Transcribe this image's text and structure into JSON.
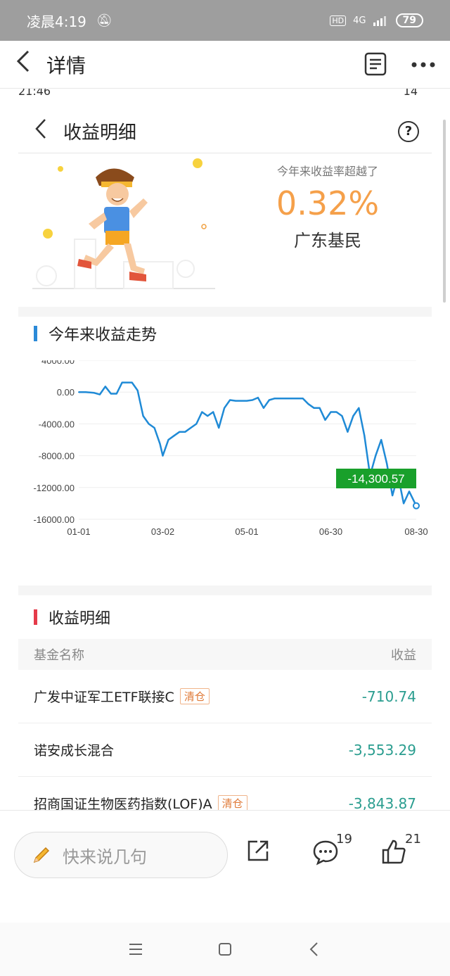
{
  "status_bar": {
    "time": "凌晨4:19",
    "network": "4G",
    "battery": "79"
  },
  "appbar": {
    "title": "详情"
  },
  "inner": {
    "status_time": "21:46",
    "status_battery": "14",
    "title": "收益明细",
    "hero": {
      "hint": "今年来收益率超越了",
      "percent": "0.32%",
      "who": "广东基民"
    }
  },
  "trend": {
    "title": "今年来收益走势",
    "accent": "#2b8ad8",
    "line_color": "#1f8ad6",
    "label_color": "#19a02b"
  },
  "chart_data": {
    "type": "line",
    "title": "今年来收益走势",
    "y_ticks": [
      "4000.00",
      "0.00",
      "-4000.00",
      "-8000.00",
      "-12000.00",
      "-16000.00"
    ],
    "x_ticks": [
      "01-01",
      "03-02",
      "05-01",
      "06-30",
      "08-30"
    ],
    "ylim": [
      -16000,
      4000
    ],
    "last_value_label": "-14,300.57",
    "series": [
      {
        "x": [
          "01-01",
          "01-06",
          "01-12",
          "01-16",
          "01-20",
          "01-24",
          "01-28",
          "02-01",
          "02-05",
          "02-08",
          "02-12",
          "02-16",
          "02-20",
          "02-24",
          "02-28",
          "03-02",
          "03-06",
          "03-10",
          "03-14",
          "03-18",
          "03-22",
          "03-26",
          "03-30",
          "04-03",
          "04-07",
          "04-11",
          "04-15",
          "04-19",
          "04-23",
          "04-27",
          "05-01",
          "05-05",
          "05-09",
          "05-13",
          "05-17",
          "05-21",
          "05-25",
          "05-29",
          "06-02",
          "06-06",
          "06-10",
          "06-14",
          "06-18",
          "06-22",
          "06-26",
          "06-30",
          "07-04",
          "07-08",
          "07-12",
          "07-16",
          "07-20",
          "07-24",
          "07-28",
          "08-01",
          "08-05",
          "08-09",
          "08-13",
          "08-17",
          "08-21",
          "08-25",
          "08-30"
        ],
        "values": [
          0,
          0,
          -100,
          -300,
          700,
          -200,
          -200,
          1200,
          1200,
          1200,
          200,
          -3000,
          -4000,
          -4500,
          -6500,
          -8000,
          -6000,
          -5500,
          -5000,
          -5000,
          -4500,
          -4000,
          -2500,
          -3000,
          -2500,
          -4500,
          -2000,
          -1000,
          -1100,
          -1100,
          -1100,
          -1000,
          -700,
          -2000,
          -1000,
          -800,
          -800,
          -800,
          -800,
          -800,
          -800,
          -1500,
          -2000,
          -2000,
          -3500,
          -2500,
          -2500,
          -3000,
          -5000,
          -3000,
          -2000,
          -5500,
          -10500,
          -8000,
          -6000,
          -9000,
          -13000,
          -10500,
          -14000,
          -12500,
          -14300
        ]
      }
    ]
  },
  "detail": {
    "title": "收益明细",
    "accent": "#e53b4a",
    "col_name": "基金名称",
    "col_value": "收益",
    "rows": [
      {
        "name": "广发中证军工ETF联接C",
        "tag": "清仓",
        "value": "-710.74"
      },
      {
        "name": "诺安成长混合",
        "tag": "",
        "value": "-3,553.29"
      },
      {
        "name": "招商国证生物医药指数(LOF)A",
        "tag": "清仓",
        "value": "-3,843.87"
      }
    ]
  },
  "bottom": {
    "placeholder": "快来说几句",
    "comments": "19",
    "likes": "21"
  }
}
